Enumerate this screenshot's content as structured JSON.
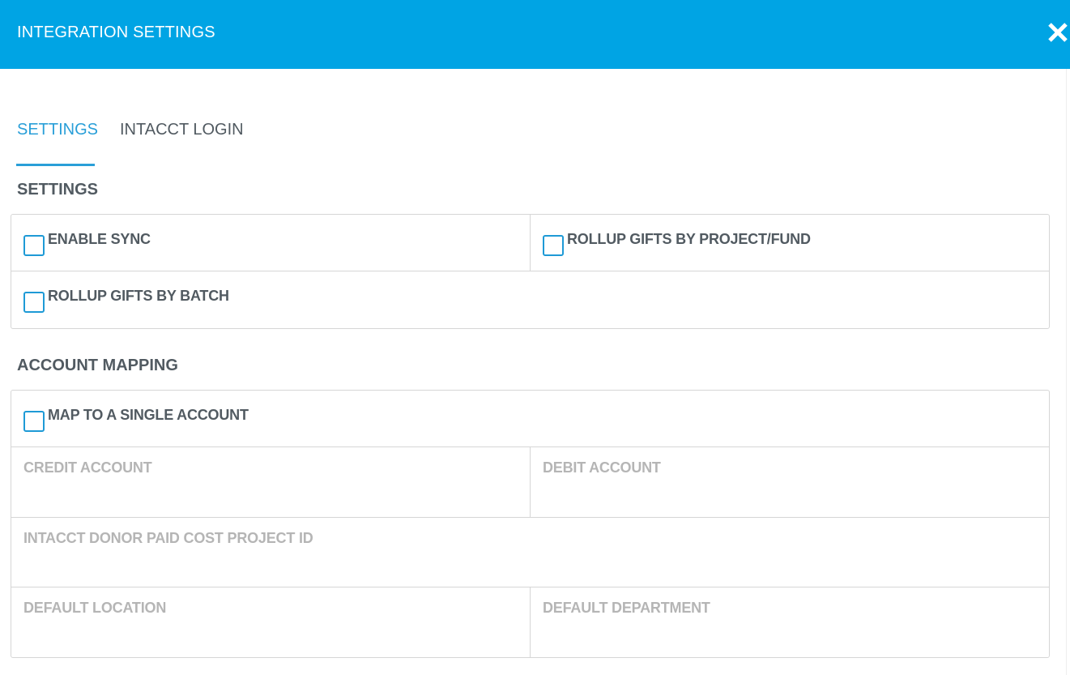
{
  "header": {
    "title": "INTEGRATION SETTINGS",
    "close_icon": "close-icon",
    "color": "#00a4e4"
  },
  "tabs": [
    {
      "label": "SETTINGS",
      "active": true
    },
    {
      "label": "INTACCT LOGIN",
      "active": false
    }
  ],
  "settings": {
    "heading": "SETTINGS",
    "options": [
      {
        "label": "ENABLE SYNC",
        "checked": false
      },
      {
        "label": "ROLLUP GIFTS BY PROJECT/FUND",
        "checked": false
      },
      {
        "label": "ROLLUP GIFTS BY BATCH",
        "checked": false
      }
    ]
  },
  "mapping": {
    "heading": "ACCOUNT MAPPING",
    "single_account": {
      "label": "MAP TO A SINGLE ACCOUNT",
      "checked": false
    },
    "fields": {
      "credit_account": {
        "label": "CREDIT ACCOUNT",
        "value": ""
      },
      "debit_account": {
        "label": "DEBIT ACCOUNT",
        "value": ""
      },
      "donor_paid_cost_project_id": {
        "label": "INTACCT DONOR PAID COST PROJECT ID",
        "value": ""
      },
      "default_location": {
        "label": "DEFAULT LOCATION",
        "value": ""
      },
      "default_department": {
        "label": "DEFAULT DEPARTMENT",
        "value": ""
      }
    }
  },
  "colors": {
    "accent": "#2a9fd8",
    "checkbox_border": "#1e9ad6",
    "text": "#515a61",
    "muted": "#b5b5b5",
    "border": "#d6d6d6"
  }
}
